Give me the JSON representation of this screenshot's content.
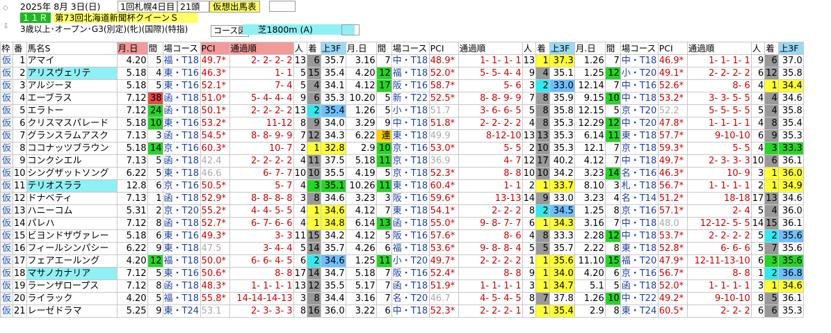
{
  "header": {
    "date": "2025年 8月 3日(日)",
    "meeting": "1回札幌4日目",
    "heads": "21頭",
    "tab_label": "仮想出馬表",
    "race_no": "１１Ｒ",
    "race_name": "第73回北海道新聞杯クイーンＳ",
    "conditions": "3歳以上･オープン･G3(別定)(牝)(国際)(特指)",
    "course_label": "コース図",
    "course": "芝1800m (A)"
  },
  "columns": [
    "枠",
    "番",
    "馬名S",
    "月.日",
    "間",
    "場コース",
    "PCI",
    "通過順",
    "人",
    "着",
    "上3F",
    "月.日",
    "間",
    "場コース",
    "PCI",
    "通過順",
    "人",
    "着",
    "上3F",
    "月.日",
    "間",
    "場コース",
    "PCI",
    "通過順",
    "人",
    "着",
    "上3F"
  ],
  "colors": {
    "green": "#27d427",
    "cyan": "#32e8f0",
    "yellow": "#ffff32",
    "orange": "#ffd200",
    "gray": "#999",
    "red": "#e84848",
    "light_cyan": "#8ff0f5",
    "light_blue": "#6fbfff"
  },
  "rows": [
    {
      "waku": "仮",
      "no": "1",
      "name": "アマイ",
      "hl": "",
      "r": [
        [
          "4.20",
          "5",
          "福・T18",
          "49.7*",
          "2- 2- 2- 2",
          "13",
          "6",
          "35.7",
          ""
        ],
        [
          "3.16",
          "7",
          "中・T18",
          "48.9*",
          "1- 1- 1- 1",
          "13",
          "1",
          "37.3",
          ""
        ],
        [
          "1.26",
          "7",
          "中・T18",
          "46.9*",
          "1- 1- 1- 1",
          "9",
          "6",
          "37.0",
          ""
        ]
      ]
    },
    {
      "waku": "仮",
      "no": "2",
      "name": "アリスヴェリテ",
      "hl": "cyan",
      "r": [
        [
          "5.18",
          "4",
          "東・T16",
          "46.3*",
          "1- 1",
          "5",
          "15",
          "35.4",
          ""
        ],
        [
          "4.20",
          "12",
          "福・T18",
          "52.0*",
          "5- 5- 4- 4",
          "9",
          "4",
          "35.1",
          ""
        ],
        [
          "1.25",
          "12",
          "小・T20",
          "49.1*",
          "2- 2- 2- 2",
          "6",
          "12",
          "35.8",
          ""
        ]
      ]
    },
    {
      "waku": "仮",
      "no": "3",
      "name": "アルジーヌ",
      "hl": "",
      "r": [
        [
          "5.18",
          "5",
          "東・T16",
          "52.1*",
          "7- 4",
          "5",
          "4",
          "34.1",
          ""
        ],
        [
          "4.12",
          "17",
          "阪・T16",
          "58.7*",
          "5- 6",
          "3",
          "2",
          "33.0",
          ""
        ],
        [
          "12.14",
          "7",
          "中・T16",
          "52.6*",
          "8- 6",
          "4",
          "1",
          "34.4",
          ""
        ]
      ]
    },
    {
      "waku": "仮",
      "no": "4",
      "name": "エーブラス",
      "hl": "",
      "r": [
        [
          "7.12",
          "38",
          "函・T18",
          "51.0*",
          "5- 4- 4- 4",
          "9",
          "6",
          "35.3",
          ""
        ],
        [
          "10.20",
          "5",
          "新・T22",
          "52.5*",
          "8- 8- 9- 9",
          "7",
          "8",
          "35.9",
          ""
        ],
        [
          "9.15",
          "10",
          "中・T18",
          "53.2*",
          "3- 3- 5- 5",
          "4",
          "4",
          "34.6",
          ""
        ]
      ]
    },
    {
      "waku": "仮",
      "no": "5",
      "name": "エラトー",
      "hl": "",
      "r": [
        [
          "7.12",
          "24",
          "函・T18",
          "50.1*",
          "2- 2- 2- 2",
          "13",
          "2",
          "35.4",
          ""
        ],
        [
          "1.26",
          "5",
          "小・T18",
          "51.7",
          "3- 6- 6- 5",
          "5",
          "8",
          "35.8",
          ""
        ],
        [
          "12.15",
          "5",
          "京・T20",
          "52.2",
          "5- 5- 5- 5",
          "5",
          "4",
          "35.8",
          ""
        ]
      ]
    },
    {
      "waku": "仮",
      "no": "6",
      "name": "クリスマスパレード",
      "hl": "",
      "r": [
        [
          "5.18",
          "10",
          "東・T16",
          "53.2*",
          "11-12",
          "8",
          "9",
          "34.0",
          ""
        ],
        [
          "3.29",
          "9",
          "中・T18",
          "51.8*",
          "2- 2- 2- 2",
          "4",
          "8",
          "35.3",
          ""
        ],
        [
          "12.29",
          "12",
          "中・T20",
          "47.8*",
          "1- 1- 1- 1",
          "4",
          "8",
          "35.4",
          ""
        ]
      ]
    },
    {
      "waku": "仮",
      "no": "7",
      "name": "グランスラムアスク",
      "hl": "",
      "r": [
        [
          "7.13",
          "3",
          "函・T18",
          "54.5*",
          "8- 8- 9- 9",
          "7",
          "12",
          "34.3",
          ""
        ],
        [
          "6.22",
          "連",
          "東・T18",
          "49.9",
          "8-12-10",
          "13",
          "13",
          "35.3",
          ""
        ],
        [
          "6.14",
          "11",
          "東・T18",
          "57.7*",
          "9-10-10",
          "6",
          "9",
          "35.3",
          ""
        ]
      ]
    },
    {
      "waku": "仮",
      "no": "8",
      "name": "ココナッツブラウン",
      "hl": "",
      "r": [
        [
          "5.18",
          "14",
          "京・T16",
          "60.3*",
          "10- 7",
          "2",
          "1",
          "32.8",
          ""
        ],
        [
          "2.9",
          "10",
          "京・T16",
          "53.0*",
          "5- 5",
          "2",
          "10",
          "35.3",
          ""
        ],
        [
          "12.1",
          "7",
          "京・T18",
          "59.3*",
          "5- 5",
          "4",
          "3",
          "33.3",
          ""
        ]
      ]
    },
    {
      "waku": "仮",
      "no": "9",
      "name": "コンクシエル",
      "hl": "",
      "r": [
        [
          "7.13",
          "5",
          "函・T18",
          "42.4",
          "2- 2- 2- 2",
          "4",
          "11",
          "37.5",
          ""
        ],
        [
          "5.18",
          "11",
          "京・T18",
          "36.9",
          "4- 7",
          "12",
          "17",
          "40.2",
          ""
        ],
        [
          "4.12",
          "7",
          "中・T18",
          "49.7*",
          "2- 3- 3- 3",
          "10",
          "6",
          "36.1",
          ""
        ]
      ]
    },
    {
      "waku": "仮",
      "no": "10",
      "name": "シングザットソング",
      "hl": "",
      "r": [
        [
          "6.22",
          "5",
          "東・T18",
          "46.6",
          "6- 7- 7",
          "10",
          "10",
          "35.5",
          ""
        ],
        [
          "4.19",
          "5",
          "京・T18",
          "52.3*",
          "8- 8",
          "10",
          "10",
          "34.2",
          ""
        ],
        [
          "3.23",
          "14",
          "名・T16",
          "46.3*",
          "10- 9",
          "3",
          "1",
          "36.0",
          ""
        ]
      ]
    },
    {
      "waku": "仮",
      "no": "11",
      "name": "テリオスララ",
      "hl": "cyan",
      "r": [
        [
          "12.8",
          "6",
          "京・T16",
          "50.5*",
          "5- 7",
          "4",
          "3",
          "35.1",
          ""
        ],
        [
          "10.26",
          "11",
          "東・T18",
          "60.4*",
          "1- 1",
          "2",
          "1",
          "33.7",
          ""
        ],
        [
          "8.10",
          "3",
          "札・T18",
          "56.7*",
          "1- 1- 1- 1",
          "2",
          "1",
          "34.9",
          ""
        ]
      ]
    },
    {
      "waku": "仮",
      "no": "12",
      "name": "ドナベティ",
      "hl": "",
      "r": [
        [
          "7.13",
          "1",
          "函・T18",
          "52.9*",
          "8- 8- 8- 8",
          "3",
          "8",
          "34.6",
          ""
        ],
        [
          "3.23",
          "3",
          "阪・T16",
          "59.6*",
          "13-13",
          "14",
          "9",
          "33.0",
          ""
        ],
        [
          "3.23",
          "4",
          "名・T14",
          "51.2*",
          "18-18",
          "17",
          "13",
          "34.6",
          ""
        ]
      ]
    },
    {
      "waku": "仮",
      "no": "13",
      "name": "ハニーコム",
      "hl": "",
      "r": [
        [
          "5.31",
          "2",
          "京・T20",
          "55.2*",
          "4- 4- 5- 5",
          "4",
          "1",
          "34.6",
          ""
        ],
        [
          "4.12",
          "7",
          "東・T18",
          "54.1*",
          "2- 2- 2",
          "8",
          "2",
          "34.5",
          ""
        ],
        [
          "1.25",
          "8",
          "京・T16",
          "57.1*",
          "2- 4",
          "5",
          "4",
          "36.0",
          ""
        ]
      ]
    },
    {
      "waku": "仮",
      "no": "14",
      "name": "パレハ",
      "hl": "",
      "r": [
        [
          "7.12",
          "8",
          "函・T18",
          "52.7*",
          "6- 7- 6- 6",
          "4",
          "1",
          "34.8",
          ""
        ],
        [
          "6.14",
          "13",
          "函・T18",
          "55.0*",
          "9- 8- 7- 7",
          "6",
          "1",
          "34.3",
          ""
        ],
        [
          "3.16",
          "7",
          "中・T18",
          "48.0",
          "12-12- 5- 5",
          "14",
          "15",
          "36.1",
          ""
        ]
      ]
    },
    {
      "waku": "仮",
      "no": "15",
      "name": "ビヨンドザヴァレー",
      "hl": "",
      "r": [
        [
          "5.18",
          "6",
          "東・T16",
          "49.3*",
          "3- 3",
          "11",
          "15",
          "34.2",
          ""
        ],
        [
          "4.12",
          "5",
          "阪・T16",
          "57.6*",
          "8- 6",
          "4",
          "8",
          "33.3",
          ""
        ],
        [
          "2.28",
          "12",
          "中・T18",
          "53.7*",
          "2- 2- 2- 2",
          "5",
          "2",
          "35.6",
          ""
        ]
      ]
    },
    {
      "waku": "仮",
      "no": "16",
      "name": "フィールシンパシー",
      "hl": "",
      "r": [
        [
          "6.22",
          "9",
          "東・T18",
          "47.5",
          "3- 4- 4",
          "5",
          "14",
          "35.7",
          ""
        ],
        [
          "4.26",
          "6",
          "福・T18",
          "53.6*",
          "9- 8- 8- 4",
          "5",
          "5",
          "35.7",
          ""
        ],
        [
          "2.22",
          "8",
          "東・T18",
          "52.8*",
          "6- 6- 6",
          "5",
          "7",
          "35.6",
          ""
        ]
      ]
    },
    {
      "waku": "仮",
      "no": "17",
      "name": "フェアエールング",
      "hl": "",
      "r": [
        [
          "4.20",
          "12",
          "福・T18",
          "50.0*",
          "6- 6- 4- 5",
          "6",
          "2",
          "34.6",
          ""
        ],
        [
          "1.25",
          "11",
          "小・T20",
          "49.7*",
          "2- 2- 2- 2",
          "1",
          "1",
          "35.6",
          ""
        ],
        [
          "11.10",
          "15",
          "福・T20",
          "47.9*",
          "12-11-13-10",
          "6",
          "3",
          "35.6",
          ""
        ]
      ]
    },
    {
      "waku": "仮",
      "no": "18",
      "name": "マサノカナリア",
      "hl": "cyan",
      "r": [
        [
          "7.12",
          "5",
          "東・T16",
          "50.6*",
          "8- 8",
          "17",
          "14",
          "34.7",
          ""
        ],
        [
          "5.18",
          "7",
          "阪・T16",
          "52.4*",
          "8- 8",
          "9",
          "1",
          "34.0",
          ""
        ],
        [
          "4.20",
          "6",
          "京・T16",
          "56.7*",
          "8- 8",
          "1",
          "2",
          "36.8",
          ""
        ]
      ]
    },
    {
      "waku": "仮",
      "no": "19",
      "name": "ラーンザロープス",
      "hl": "",
      "r": [
        [
          "7.12",
          "8",
          "函・T18",
          "48.3*",
          "1- 1- 1- 1",
          "13",
          "12",
          "35.5",
          ""
        ],
        [
          "5.17",
          "7",
          "函・T18",
          "51.9*",
          "1- 1- 1- 1",
          "3",
          "1",
          "34.7",
          ""
        ],
        [
          "5.1",
          "5",
          "函・T18",
          "52.0*",
          "1- 1- 1- 1",
          "3",
          "1",
          "34.6",
          ""
        ]
      ]
    },
    {
      "waku": "仮",
      "no": "20",
      "name": "ライラック",
      "hl": "",
      "r": [
        [
          "4.20",
          "5",
          "福・T18",
          "55.8*",
          "14-14-14-13",
          "3",
          "8",
          "34.4",
          ""
        ],
        [
          "3.16",
          "7",
          "名・T20",
          "46.7",
          "4- 5- 4- 5",
          "8",
          "7",
          "37.8",
          ""
        ],
        [
          "1.26",
          "10",
          "中・T22",
          "49.2*",
          "9-10-10",
          "8",
          "5",
          "36.1",
          ""
        ]
      ]
    },
    {
      "waku": "仮",
      "no": "21",
      "name": "レーゼドラマ",
      "hl": "",
      "r": [
        [
          "5.25",
          "9",
          "東・T24",
          "53.1",
          "2- 3- 3- 3",
          "8",
          "16",
          "36.0",
          ""
        ],
        [
          "3.22",
          "6",
          "中・T18",
          "52.3*",
          "2- 2- 2- 1",
          "5",
          "1",
          "35.4",
          ""
        ],
        [
          "2.9",
          "8",
          "東・T24",
          "60.5*",
          "2- 2- 2",
          "6",
          "6",
          "35.3",
          ""
        ]
      ]
    }
  ]
}
